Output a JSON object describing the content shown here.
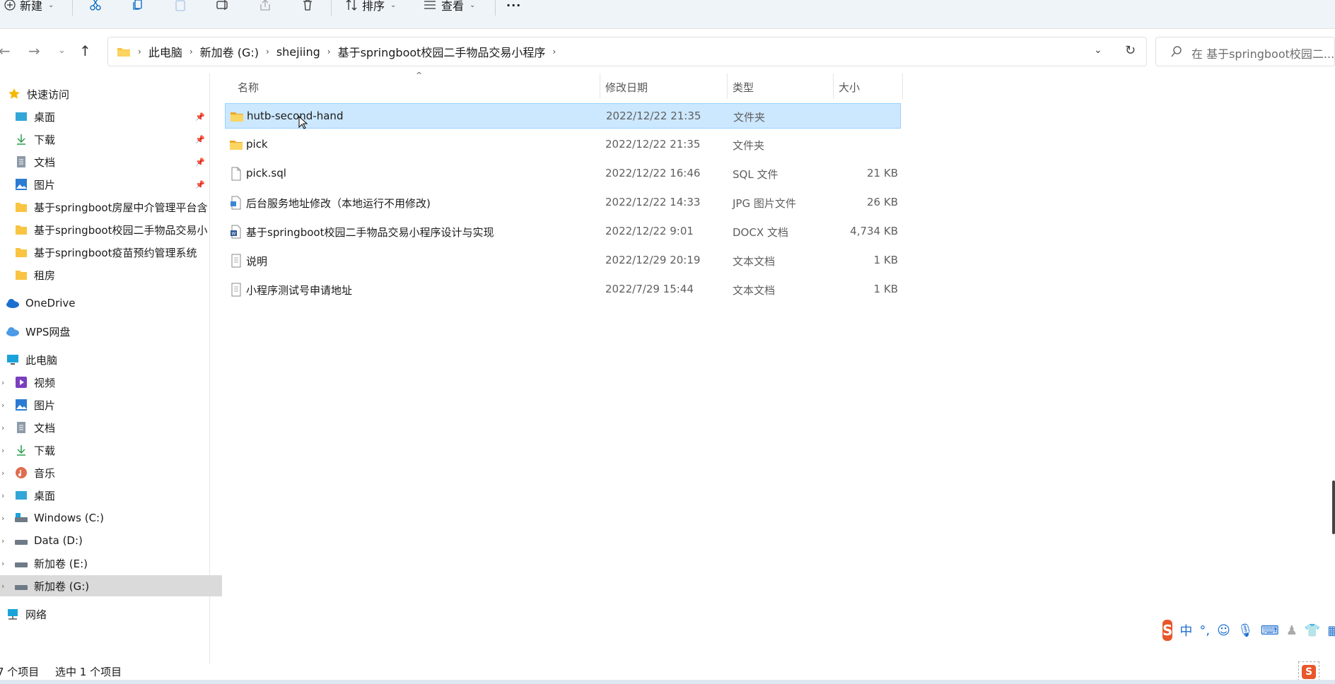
{
  "toolbar": {
    "new_label": "新建",
    "sort_label": "排序",
    "view_label": "查看",
    "more_label": "···"
  },
  "address": {
    "crumbs": [
      "此电脑",
      "新加卷 (G:)",
      "shejiing",
      "基于springboot校园二手物品交易小程序"
    ]
  },
  "search": {
    "placeholder": "在 基于springboot校园二..."
  },
  "sidebar": {
    "quick_access": "快速访问",
    "quick_items": [
      "桌面",
      "下载",
      "文档",
      "图片",
      "基于springboot房屋中介管理平台含",
      "基于springboot校园二手物品交易小",
      "基于springboot疫苗预约管理系统",
      "租房"
    ],
    "onedrive": "OneDrive",
    "wps": "WPS网盘",
    "this_pc": "此电脑",
    "pc_items": [
      "视频",
      "图片",
      "文档",
      "下载",
      "音乐",
      "桌面",
      "Windows (C:)",
      "Data (D:)",
      "新加卷 (E:)",
      "新加卷 (G:)"
    ],
    "network": "网络"
  },
  "columns": {
    "name": "名称",
    "date": "修改日期",
    "type": "类型",
    "size": "大小"
  },
  "files": [
    {
      "name": "hutb-second-hand",
      "date": "2022/12/22 21:35",
      "type": "文件夹",
      "size": "",
      "icon": "folder-icon"
    },
    {
      "name": "pick",
      "date": "2022/12/22 21:35",
      "type": "文件夹",
      "size": "",
      "icon": "folder-icon"
    },
    {
      "name": "pick.sql",
      "date": "2022/12/22 16:46",
      "type": "SQL 文件",
      "size": "21 KB",
      "icon": "file-icon"
    },
    {
      "name": "后台服务地址修改（本地运行不用修改)",
      "date": "2022/12/22 14:33",
      "type": "JPG 图片文件",
      "size": "26 KB",
      "icon": "image-file-icon"
    },
    {
      "name": "基于springboot校园二手物品交易小程序设计与实现",
      "date": "2022/12/22 9:01",
      "type": "DOCX 文档",
      "size": "4,734 KB",
      "icon": "word-file-icon"
    },
    {
      "name": "说明",
      "date": "2022/12/29 20:19",
      "type": "文本文档",
      "size": "1 KB",
      "icon": "text-file-icon"
    },
    {
      "name": "小程序测试号申请地址",
      "date": "2022/7/29 15:44",
      "type": "文本文档",
      "size": "1 KB",
      "icon": "text-file-icon"
    }
  ],
  "status": {
    "count": "7 个项目",
    "selected": "选中 1 个项目"
  },
  "ime": {
    "lang": "中"
  },
  "colors": {
    "selection": "#cce8ff",
    "accent": "#0067c0",
    "folder": "#f8c441"
  }
}
